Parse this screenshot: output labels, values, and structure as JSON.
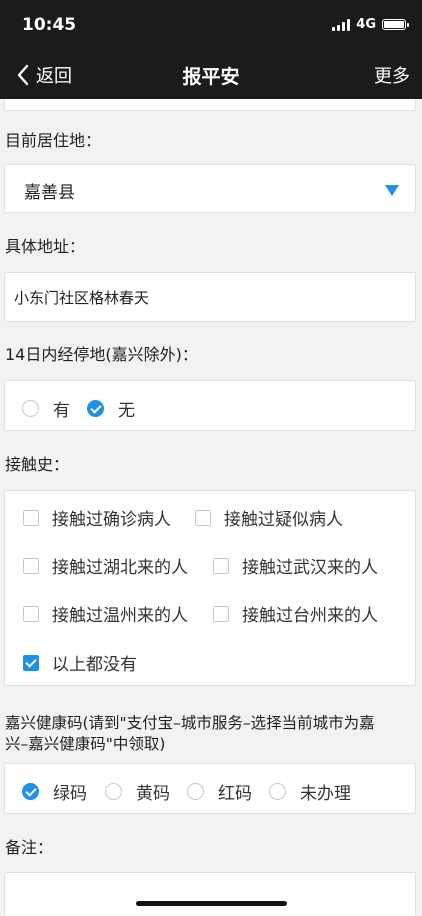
{
  "status_bar": {
    "time": "10:45",
    "network": "4G"
  },
  "nav": {
    "back_label": "返回",
    "title": "报平安",
    "more_label": "更多"
  },
  "residence": {
    "label": "目前居住地：",
    "value": "嘉善县"
  },
  "address": {
    "label": "具体地址：",
    "value": "小东门社区格林春天"
  },
  "stopover": {
    "label": "14日内经停地(嘉兴除外)：",
    "options": [
      {
        "label": "有",
        "selected": false
      },
      {
        "label": "无",
        "selected": true
      }
    ]
  },
  "contact": {
    "label": "接触史：",
    "options": [
      {
        "label": "接触过确诊病人",
        "checked": false
      },
      {
        "label": "接触过疑似病人",
        "checked": false
      },
      {
        "label": "接触过湖北来的人",
        "checked": false
      },
      {
        "label": "接触过武汉来的人",
        "checked": false
      },
      {
        "label": "接触过温州来的人",
        "checked": false
      },
      {
        "label": "接触过台州来的人",
        "checked": false
      },
      {
        "label": "以上都没有",
        "checked": true
      }
    ]
  },
  "health_code": {
    "label_line1": "嘉兴健康码(请到\"支付宝–城市服务–选择当前城市为嘉",
    "label_line2": "兴–嘉兴健康码\"中领取)",
    "options": [
      {
        "label": "绿码",
        "selected": true
      },
      {
        "label": "黄码",
        "selected": false
      },
      {
        "label": "红码",
        "selected": false
      },
      {
        "label": "未办理",
        "selected": false
      }
    ]
  },
  "remarks": {
    "label": "备注："
  },
  "colors": {
    "accent": "#1e90e6",
    "nav_bg": "#1b1b1b",
    "page_bg": "#f2f2f2"
  }
}
